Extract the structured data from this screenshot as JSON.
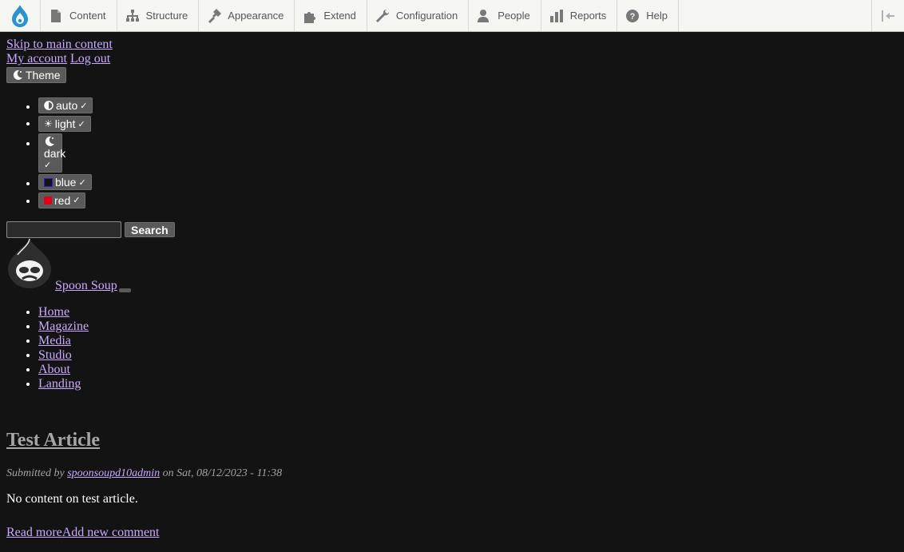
{
  "toolbar": {
    "items": [
      {
        "label": "Content",
        "icon": "content-icon"
      },
      {
        "label": "Structure",
        "icon": "structure-icon"
      },
      {
        "label": "Appearance",
        "icon": "appearance-icon"
      },
      {
        "label": "Extend",
        "icon": "extend-icon"
      },
      {
        "label": "Configuration",
        "icon": "configuration-icon"
      },
      {
        "label": "People",
        "icon": "people-icon"
      },
      {
        "label": "Reports",
        "icon": "reports-icon"
      },
      {
        "label": "Help",
        "icon": "help-icon"
      }
    ]
  },
  "skip_link": "Skip to main content",
  "account": {
    "my_account": "My account",
    "log_out": "Log out"
  },
  "theme": {
    "button_label": "Theme",
    "options": [
      {
        "label": "auto"
      },
      {
        "label": "light"
      },
      {
        "label": "dark"
      },
      {
        "label": "blue",
        "color": "#2a1ad0"
      },
      {
        "label": "red",
        "color": "#e0001a"
      }
    ]
  },
  "search": {
    "button_label": "Search",
    "value": ""
  },
  "site": {
    "name": "Spoon Soup"
  },
  "nav": {
    "items": [
      "Home",
      "Magazine",
      "Media",
      "Studio",
      "About",
      "Landing"
    ]
  },
  "article": {
    "title": "Test Article",
    "submitted_by": "Submitted by",
    "author": "spoonsoupd10admin",
    "on": "on",
    "date": "Sat, 08/12/2023 - 11:38",
    "body": "No content on test article.",
    "read_more": "Read more",
    "add_comment": "Add new comment"
  }
}
